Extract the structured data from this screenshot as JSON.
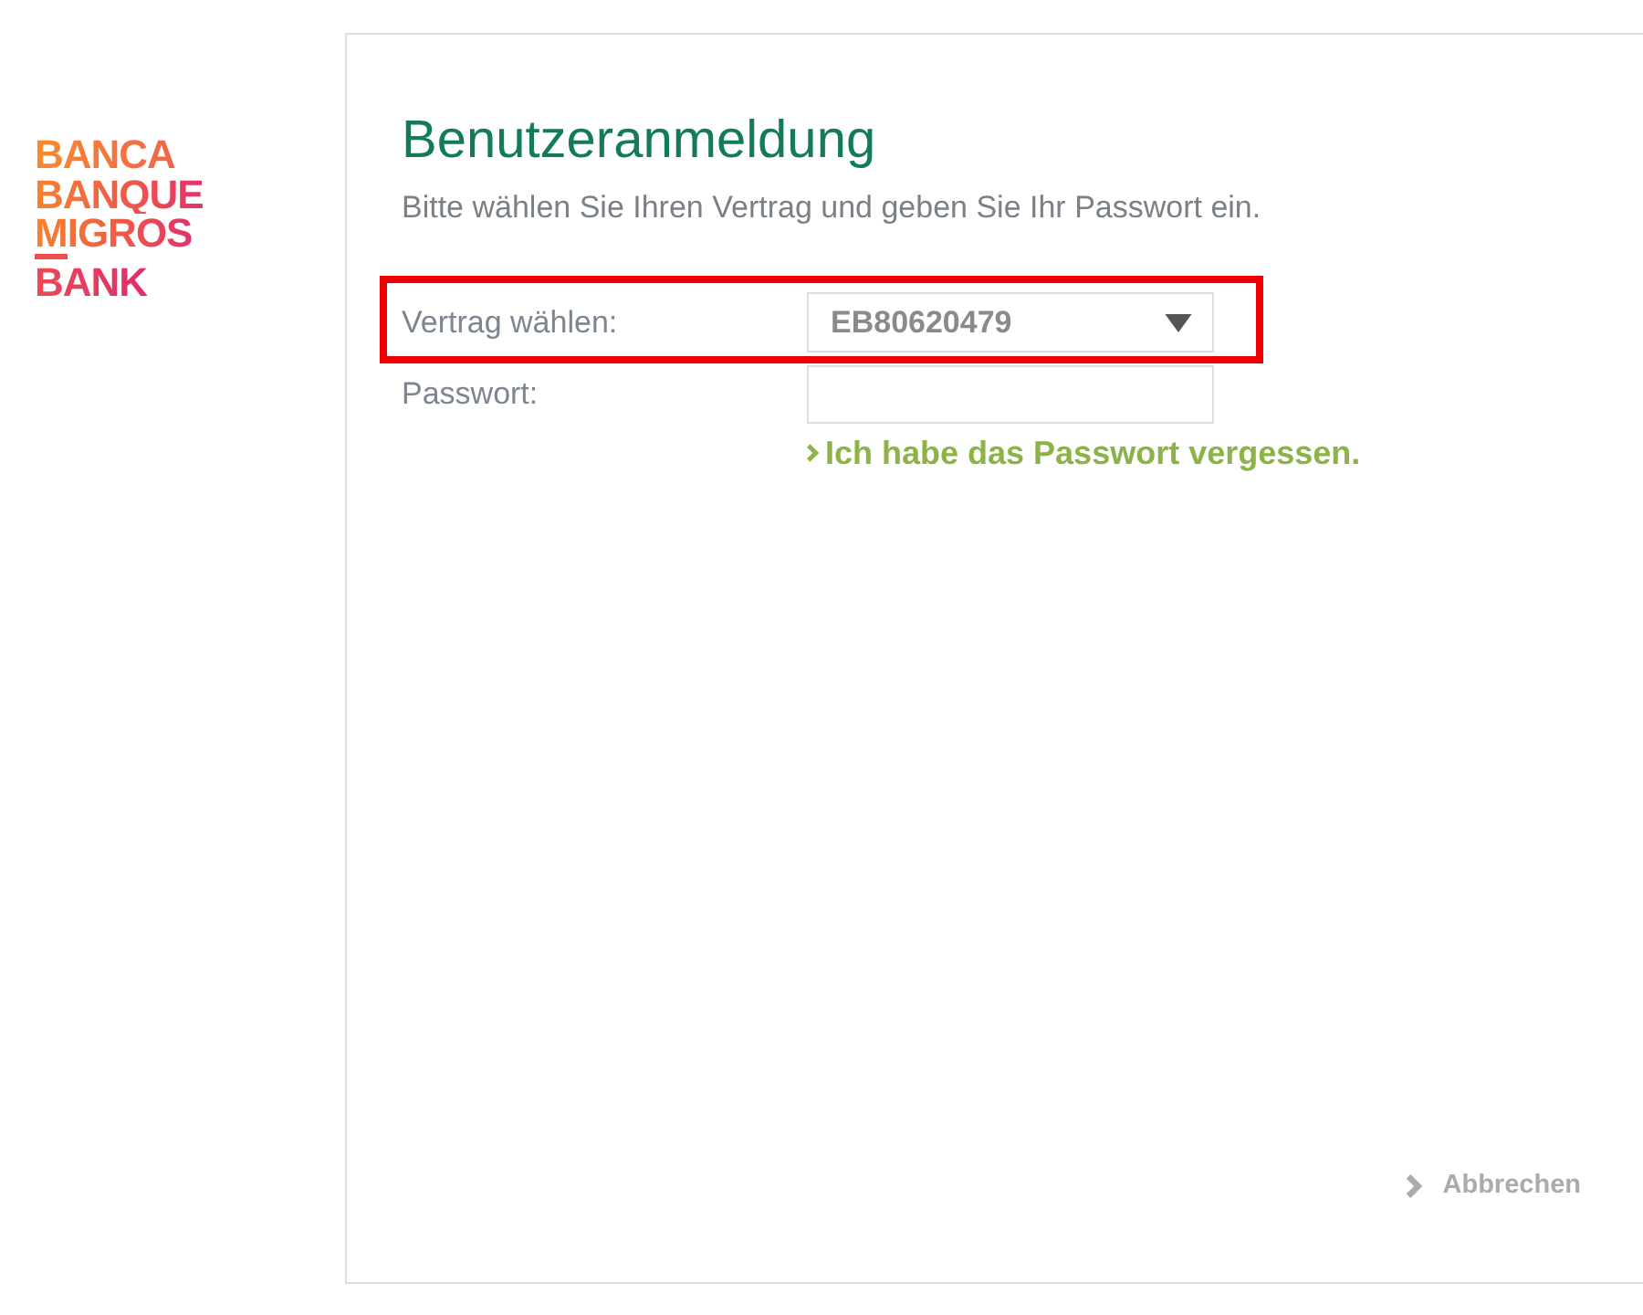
{
  "logo": {
    "lines": [
      "BANCA",
      "BANQUE",
      "MIGROS",
      "BANK"
    ]
  },
  "login": {
    "title": "Benutzeranmeldung",
    "intro": "Bitte wählen Sie Ihren Vertrag und geben Sie Ihr Passwort ein.",
    "contract": {
      "label": "Vertrag wählen:",
      "value": "EB80620479",
      "highlighted": true
    },
    "password": {
      "label": "Passwort:"
    },
    "forgot_link": "Ich habe das Passwort vergessen.",
    "cancel_button": {
      "label": "Abbrechen",
      "disabled": true
    }
  }
}
